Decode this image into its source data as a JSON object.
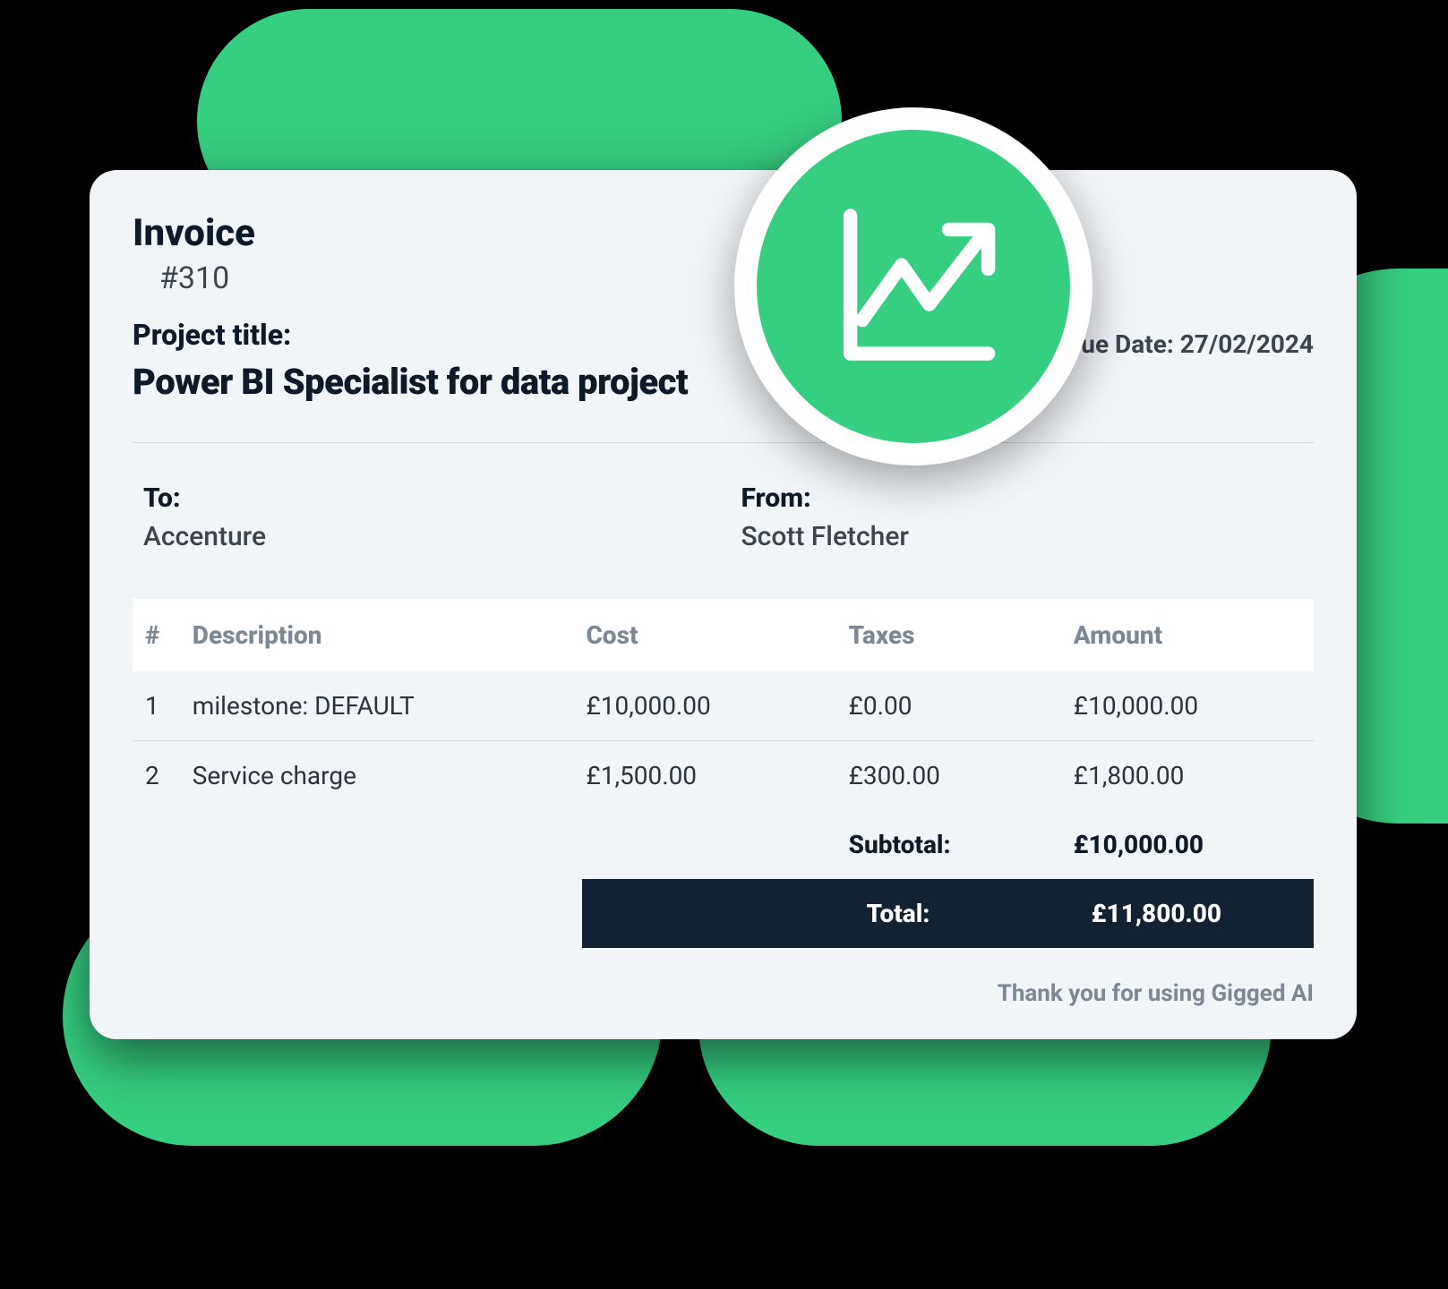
{
  "invoice": {
    "title": "Invoice",
    "number": "#310",
    "project_label": "Project title:",
    "project_value": "Power BI Specialist for data project",
    "issue_date_label": "Issue Date:",
    "issue_date_value": "27/02/2024",
    "to_label": "To:",
    "to_value": "Accenture",
    "from_label": "From:",
    "from_value": "Scott Fletcher",
    "columns": {
      "idx": "#",
      "description": "Description",
      "cost": "Cost",
      "taxes": "Taxes",
      "amount": "Amount"
    },
    "items": [
      {
        "idx": "1",
        "description": "milestone: DEFAULT",
        "cost": "£10,000.00",
        "taxes": "£0.00",
        "amount": "£10,000.00"
      },
      {
        "idx": "2",
        "description": "Service charge",
        "cost": "£1,500.00",
        "taxes": "£300.00",
        "amount": "£1,800.00"
      }
    ],
    "subtotal_label": "Subtotal:",
    "subtotal_value": "£10,000.00",
    "total_label": "Total:",
    "total_value": "£11,800.00",
    "footer": "Thank you for using Gigged AI"
  },
  "colors": {
    "accent": "#36cf82",
    "dark": "#122233"
  }
}
